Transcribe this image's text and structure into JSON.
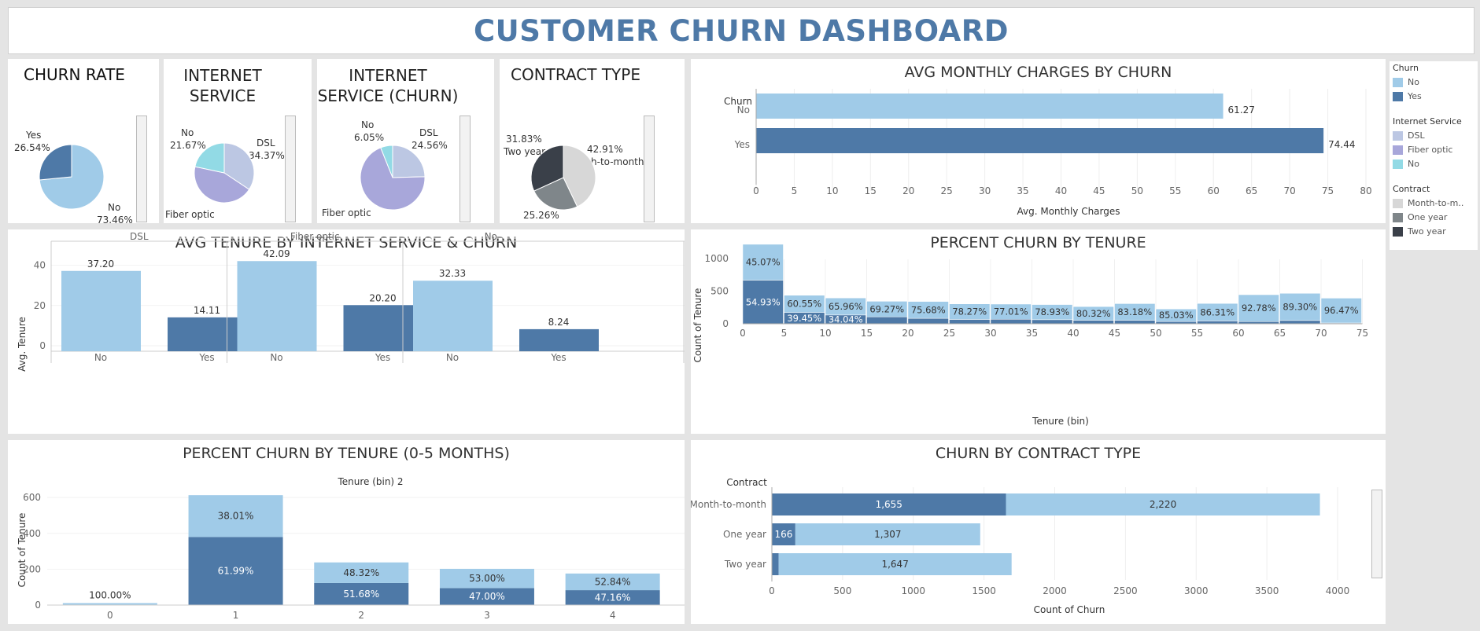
{
  "dashboard_title": "CUSTOMER CHURN DASHBOARD",
  "colors": {
    "no": "#a0cbe8",
    "yes": "#4e79a7",
    "dsl": "#bcc7e3",
    "fiber": "#a8a7da",
    "nosvc": "#92dae5",
    "m2m": "#d7d7d7",
    "oneyr": "#7f868a",
    "twoyr": "#3a4049"
  },
  "panels": {
    "churn_rate": {
      "title": "CHURN RATE",
      "labels": [
        {
          "name": "Yes",
          "pct": "26.54%"
        },
        {
          "name": "No",
          "pct": "73.46%"
        }
      ]
    },
    "internet_service": {
      "title_l1": "INTERNET",
      "title_l2": "SERVICE",
      "labels": [
        {
          "name": "No",
          "pct": "21.67%"
        },
        {
          "name": "DSL",
          "pct": "34.37%"
        },
        {
          "name": "Fiber optic",
          "pct": ""
        }
      ]
    },
    "internet_service_churn": {
      "title_l1": "INTERNET",
      "title_l2": "SERVICE (CHURN)",
      "labels": [
        {
          "name": "No",
          "pct": "6.05%"
        },
        {
          "name": "DSL",
          "pct": "24.56%"
        },
        {
          "name": "Fiber optic",
          "pct": ""
        }
      ]
    },
    "contract_type": {
      "title": "CONTRACT TYPE",
      "labels": [
        {
          "name": "Two year",
          "pct": "31.83%"
        },
        {
          "name": "Month-to-month",
          "pct": "42.91%"
        },
        {
          "name": "",
          "pct": "25.26%"
        }
      ]
    },
    "avg_monthly": {
      "title": "AVG MONTHLY CHARGES BY CHURN",
      "header": "Churn",
      "xlabel": "Avg. Monthly Charges"
    },
    "avg_tenure": {
      "title": "AVG TENURE BY INTERNET SERVICE & CHURN",
      "ylabel": "Avg. Tenure"
    },
    "pct_tenure": {
      "title": "PERCENT CHURN BY TENURE",
      "ylabel": "Count of Tenure",
      "xlabel": "Tenure (bin)"
    },
    "pct_tenure_05": {
      "title": "PERCENT CHURN BY TENURE (0-5 MONTHS)",
      "header": "Tenure (bin) 2",
      "ylabel": "Count of Tenure"
    },
    "contract_churn": {
      "title": "CHURN BY CONTRACT TYPE",
      "header": "Contract",
      "xlabel": "Count of Churn"
    }
  },
  "legend": {
    "churn": {
      "title": "Churn",
      "items": [
        "No",
        "Yes"
      ]
    },
    "internet": {
      "title": "Internet Service",
      "items": [
        "DSL",
        "Fiber optic",
        "No"
      ]
    },
    "contract": {
      "title": "Contract",
      "items": [
        "Month-to-m..",
        "One year",
        "Two year"
      ]
    }
  },
  "chart_data": [
    {
      "type": "pie",
      "title": "CHURN RATE",
      "categories": [
        "No",
        "Yes"
      ],
      "values": [
        73.46,
        26.54
      ]
    },
    {
      "type": "pie",
      "title": "INTERNET SERVICE",
      "categories": [
        "DSL",
        "Fiber optic",
        "No"
      ],
      "values": [
        34.37,
        43.96,
        21.67
      ]
    },
    {
      "type": "pie",
      "title": "INTERNET SERVICE (CHURN)",
      "categories": [
        "DSL",
        "Fiber optic",
        "No"
      ],
      "values": [
        24.56,
        69.39,
        6.05
      ]
    },
    {
      "type": "pie",
      "title": "CONTRACT TYPE",
      "categories": [
        "Month-to-month",
        "One year",
        "Two year"
      ],
      "values": [
        42.91,
        25.26,
        31.83
      ]
    },
    {
      "type": "bar",
      "title": "AVG MONTHLY CHARGES BY CHURN",
      "categories": [
        "No",
        "Yes"
      ],
      "values": [
        61.27,
        74.44
      ],
      "value_labels": [
        "61.27",
        "74.44"
      ],
      "xlabel": "Avg. Monthly Charges",
      "xlim": [
        0,
        80
      ],
      "ticks": [
        0,
        5,
        10,
        15,
        20,
        25,
        30,
        35,
        40,
        45,
        50,
        55,
        60,
        65,
        70,
        75,
        80
      ]
    },
    {
      "type": "bar",
      "title": "AVG TENURE BY INTERNET SERVICE & CHURN",
      "groups": [
        "DSL",
        "Fiber optic",
        "No"
      ],
      "categories": [
        "No",
        "Yes"
      ],
      "values": [
        [
          37.2,
          14.11
        ],
        [
          42.09,
          20.2
        ],
        [
          32.33,
          8.24
        ]
      ],
      "value_labels": [
        [
          "37.20",
          "14.11"
        ],
        [
          "42.09",
          "20.20"
        ],
        [
          "32.33",
          "8.24"
        ]
      ],
      "ylabel": "Avg. Tenure",
      "ylim": [
        0,
        50
      ],
      "ticks": [
        0,
        20,
        40
      ]
    },
    {
      "type": "bar",
      "title": "PERCENT CHURN BY TENURE",
      "stacked": true,
      "bins": [
        0,
        5,
        10,
        15,
        20,
        25,
        30,
        35,
        40,
        45,
        50,
        55,
        60,
        65,
        70
      ],
      "yes_counts": [
        668,
        172,
        134,
        106,
        83,
        66,
        69,
        62,
        52,
        52,
        34,
        43,
        33,
        50,
        12
      ],
      "no_counts": [
        549,
        264,
        261,
        238,
        258,
        238,
        232,
        232,
        211,
        256,
        192,
        268,
        412,
        416,
        380
      ],
      "pct_no": [
        "45.07%",
        "60.55%",
        "65.96%",
        "69.27%",
        "75.68%",
        "78.27%",
        "77.01%",
        "78.93%",
        "80.32%",
        "83.18%",
        "85.03%",
        "86.31%",
        "92.78%",
        "89.30%",
        "96.47%"
      ],
      "pct_yes": [
        "54.93%",
        "39.45%",
        "34.04%",
        "",
        "",
        "",
        "",
        "",
        "",
        "",
        "",
        "",
        "",
        "",
        ""
      ],
      "xlabel": "Tenure (bin)",
      "ylabel": "Count of Tenure",
      "xticks": [
        0,
        5,
        10,
        15,
        20,
        25,
        30,
        35,
        40,
        45,
        50,
        55,
        60,
        65,
        70,
        75
      ],
      "yticks": [
        0,
        500,
        1000
      ],
      "ylim": [
        0,
        1300
      ]
    },
    {
      "type": "bar",
      "title": "PERCENT CHURN BY TENURE (0-5 MONTHS)",
      "stacked": true,
      "categories": [
        "0",
        "1",
        "2",
        "3",
        "4"
      ],
      "yes_counts": [
        0,
        380,
        123,
        95,
        83
      ],
      "no_counts": [
        11,
        233,
        115,
        107,
        93
      ],
      "pct_no": [
        "100.00%",
        "38.01%",
        "48.32%",
        "53.00%",
        "52.84%"
      ],
      "pct_yes": [
        "",
        "61.99%",
        "51.68%",
        "47.00%",
        "47.16%"
      ],
      "ylabel": "Count of Tenure",
      "yticks": [
        0,
        200,
        400,
        600
      ],
      "ylim": [
        0,
        640
      ]
    },
    {
      "type": "bar",
      "title": "CHURN BY CONTRACT TYPE",
      "stacked": true,
      "categories": [
        "Month-to-month",
        "One year",
        "Two year"
      ],
      "yes": [
        1655,
        166,
        48
      ],
      "no": [
        2220,
        1307,
        1647
      ],
      "yes_labels": [
        "1,655",
        "166",
        ""
      ],
      "no_labels": [
        "2,220",
        "1,307",
        "1,647"
      ],
      "xlabel": "Count of Churn",
      "xlim": [
        0,
        4100
      ],
      "ticks": [
        0,
        500,
        1000,
        1500,
        2000,
        2500,
        3000,
        3500,
        4000
      ]
    }
  ]
}
